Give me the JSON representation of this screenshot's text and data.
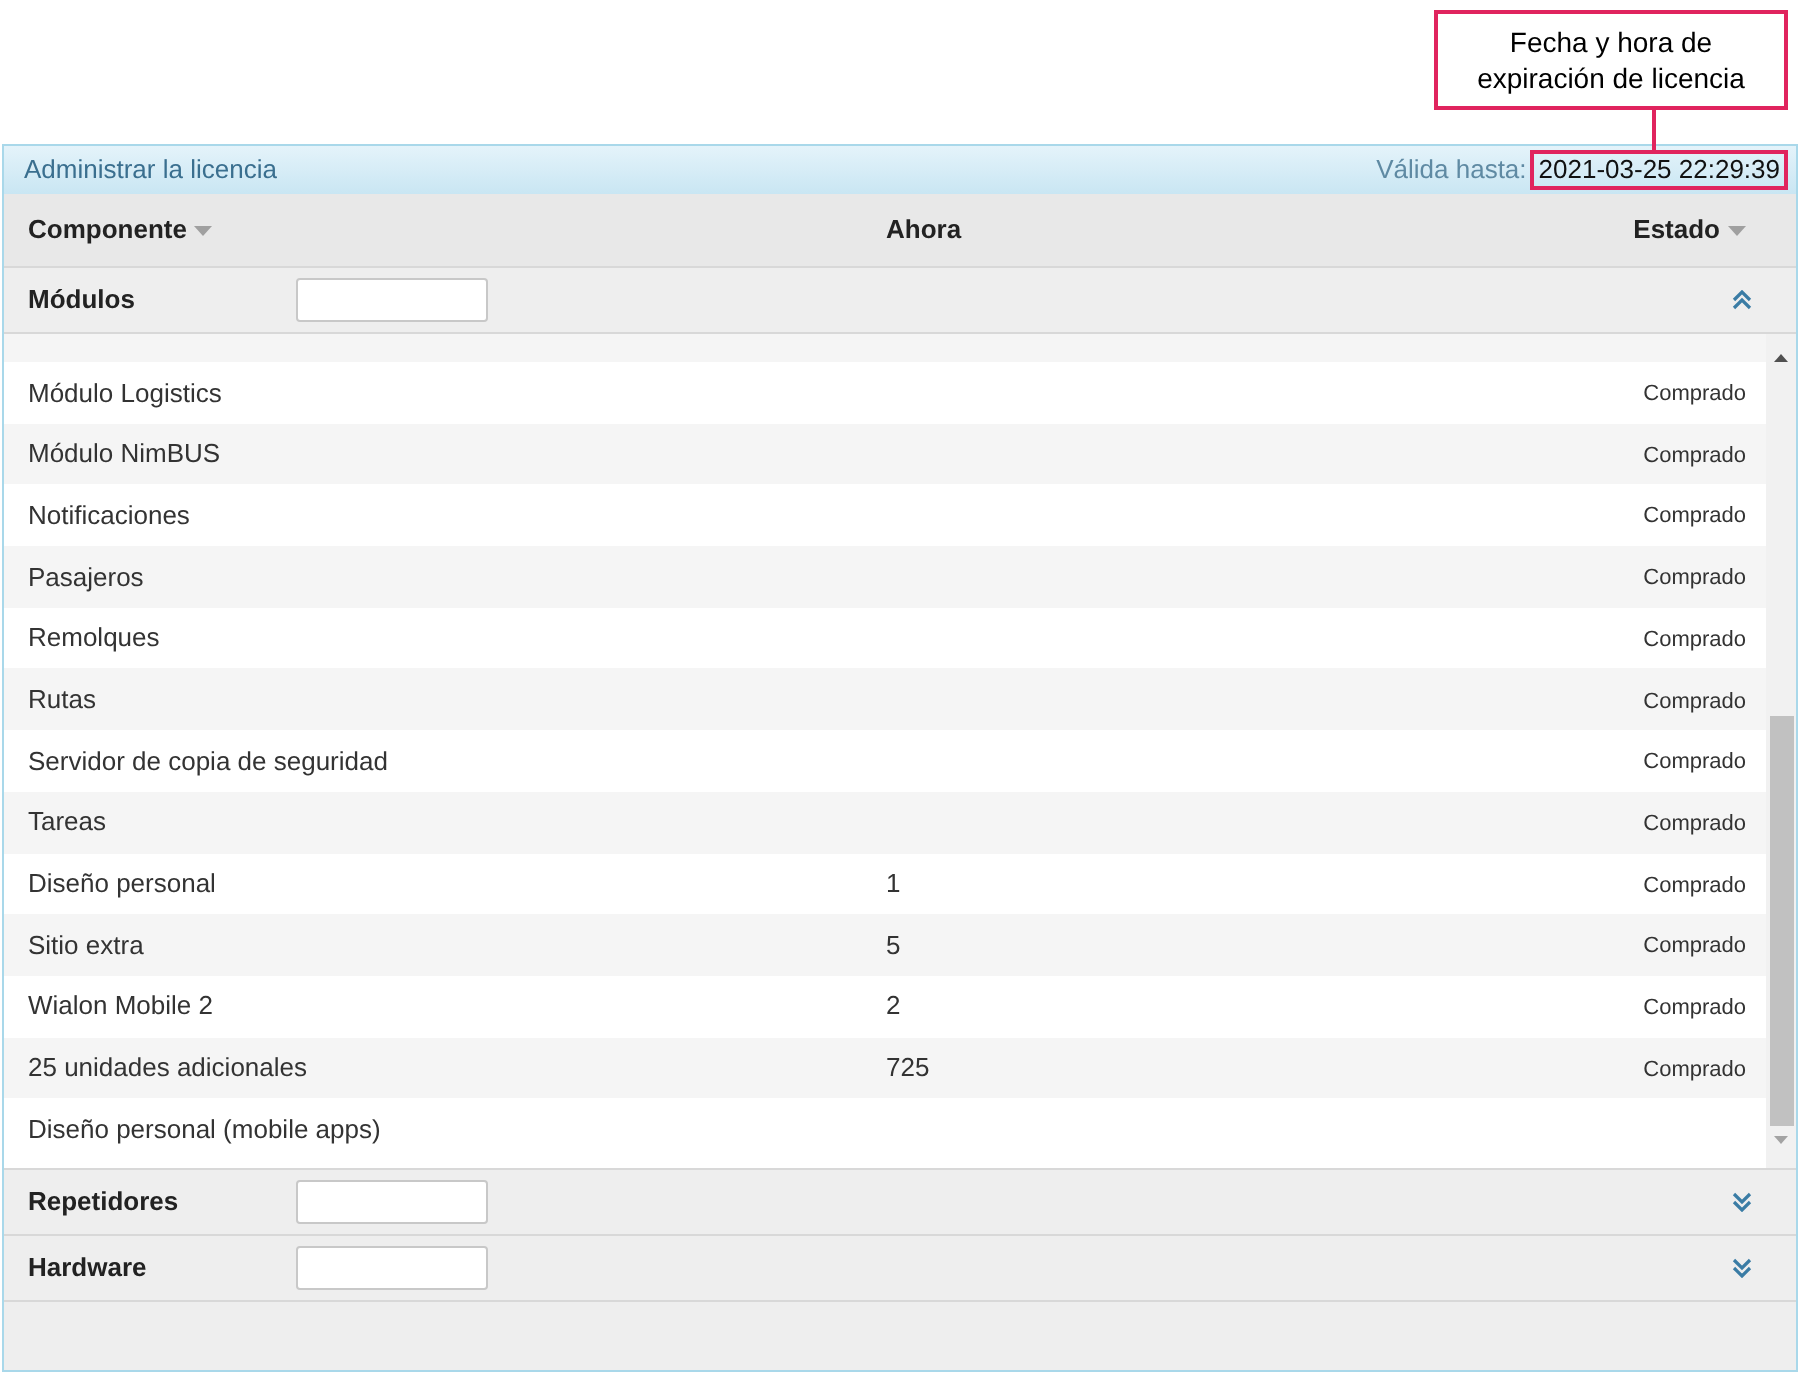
{
  "callout": {
    "text": "Fecha y hora de expiración de licencia"
  },
  "panel": {
    "title": "Administrar la licencia",
    "valid_label": "Válida hasta:",
    "valid_value": "2021-03-25 22:29:39"
  },
  "columns": [
    {
      "label": "Componente",
      "sortable": true
    },
    {
      "label": "Ahora",
      "sortable": false
    },
    {
      "label": "Estado",
      "sortable": true
    }
  ],
  "groups": [
    {
      "name": "Módulos",
      "expanded": true,
      "rows": [
        {
          "component": "Módulo Logistics",
          "now": "",
          "status": "Comprado"
        },
        {
          "component": "Módulo NimBUS",
          "now": "",
          "status": "Comprado"
        },
        {
          "component": "Notificaciones",
          "now": "",
          "status": "Comprado"
        },
        {
          "component": "Pasajeros",
          "now": "",
          "status": "Comprado"
        },
        {
          "component": "Remolques",
          "now": "",
          "status": "Comprado"
        },
        {
          "component": "Rutas",
          "now": "",
          "status": "Comprado"
        },
        {
          "component": "Servidor de copia de seguridad",
          "now": "",
          "status": "Comprado"
        },
        {
          "component": "Tareas",
          "now": "",
          "status": "Comprado"
        },
        {
          "component": "Diseño personal",
          "now": "1",
          "status": "Comprado"
        },
        {
          "component": "Sitio extra",
          "now": "5",
          "status": "Comprado"
        },
        {
          "component": "Wialon Mobile 2",
          "now": "2",
          "status": "Comprado"
        },
        {
          "component": "25 unidades adicionales",
          "now": "725",
          "status": "Comprado"
        },
        {
          "component": "Diseño personal (mobile apps)",
          "now": "",
          "status": ""
        }
      ]
    },
    {
      "name": "Repetidores",
      "expanded": false
    },
    {
      "name": "Hardware",
      "expanded": false
    }
  ]
}
